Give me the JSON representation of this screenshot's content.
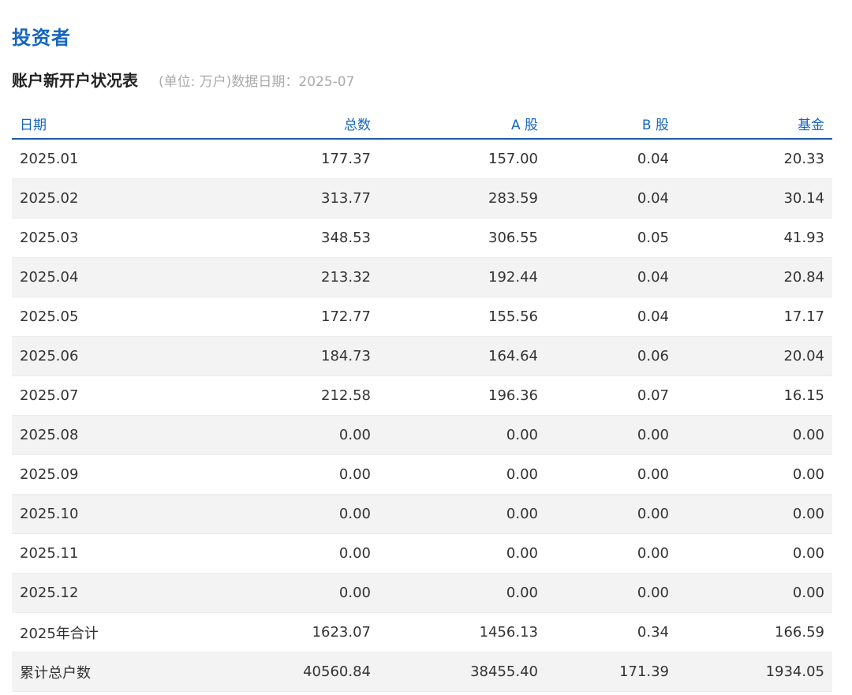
{
  "section_title": "投资者",
  "table_title": "账户新开户状况表",
  "table_meta": "(单位: 万户)数据日期：2025-07",
  "columns": [
    "日期",
    "总数",
    "A 股",
    "B 股",
    "基金"
  ],
  "rows": [
    [
      "2025.01",
      "177.37",
      "157.00",
      "0.04",
      "20.33"
    ],
    [
      "2025.02",
      "313.77",
      "283.59",
      "0.04",
      "30.14"
    ],
    [
      "2025.03",
      "348.53",
      "306.55",
      "0.05",
      "41.93"
    ],
    [
      "2025.04",
      "213.32",
      "192.44",
      "0.04",
      "20.84"
    ],
    [
      "2025.05",
      "172.77",
      "155.56",
      "0.04",
      "17.17"
    ],
    [
      "2025.06",
      "184.73",
      "164.64",
      "0.06",
      "20.04"
    ],
    [
      "2025.07",
      "212.58",
      "196.36",
      "0.07",
      "16.15"
    ],
    [
      "2025.08",
      "0.00",
      "0.00",
      "0.00",
      "0.00"
    ],
    [
      "2025.09",
      "0.00",
      "0.00",
      "0.00",
      "0.00"
    ],
    [
      "2025.10",
      "0.00",
      "0.00",
      "0.00",
      "0.00"
    ],
    [
      "2025.11",
      "0.00",
      "0.00",
      "0.00",
      "0.00"
    ],
    [
      "2025.12",
      "0.00",
      "0.00",
      "0.00",
      "0.00"
    ],
    [
      "2025年合计",
      "1623.07",
      "1456.13",
      "0.34",
      "166.59"
    ],
    [
      "累计总户数",
      "40560.84",
      "38455.40",
      "171.39",
      "1934.05"
    ]
  ]
}
